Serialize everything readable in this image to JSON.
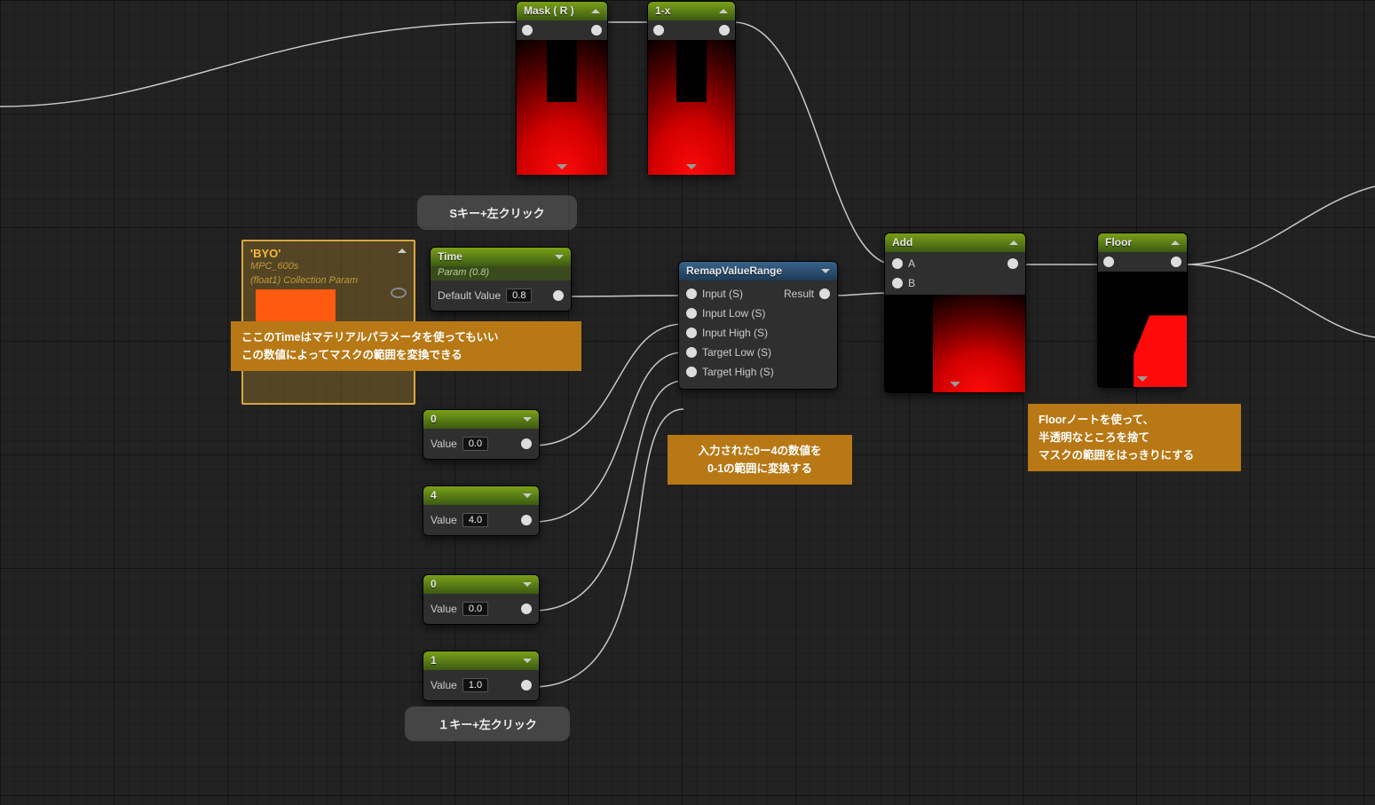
{
  "mask": {
    "title": "Mask ( R )"
  },
  "onemx": {
    "title": "1-x"
  },
  "time": {
    "title": "Time",
    "subtitle": "Param (0.8)",
    "default_label": "Default Value",
    "default_value": "0.8"
  },
  "const0a": {
    "title": "0",
    "value_label": "Value",
    "value": "0.0"
  },
  "const4": {
    "title": "4",
    "value_label": "Value",
    "value": "4.0"
  },
  "const0b": {
    "title": "0",
    "value_label": "Value",
    "value": "0.0"
  },
  "const1": {
    "title": "1",
    "value_label": "Value",
    "value": "1.0"
  },
  "remap": {
    "title": "RemapValueRange",
    "pins": {
      "input": "Input (S)",
      "input_low": "Input Low (S)",
      "input_high": "Input High (S)",
      "target_low": "Target Low (S)",
      "target_high": "Target High (S)",
      "result": "Result"
    }
  },
  "add": {
    "title": "Add",
    "a": "A",
    "b": "B"
  },
  "floor": {
    "title": "Floor"
  },
  "byo": {
    "title": "'BYO'",
    "sub1": "MPC_600s",
    "sub2": "(float1) Collection Param"
  },
  "bubbles": {
    "skey": "Sキー+左クリック",
    "onekey": "１キー+左クリック"
  },
  "notes": {
    "time_l1": "ここのTimeはマテリアルパラメータを使ってもいい",
    "time_l2": "この数値によってマスクの範囲を変換できる",
    "remap_l1": "入力された0ー4の数値を",
    "remap_l2": "0-1の範囲に変換する",
    "floor_l1": "Floorノートを使って、",
    "floor_l2": "半透明なところを捨て",
    "floor_l3": "マスクの範囲をはっきりにする"
  }
}
